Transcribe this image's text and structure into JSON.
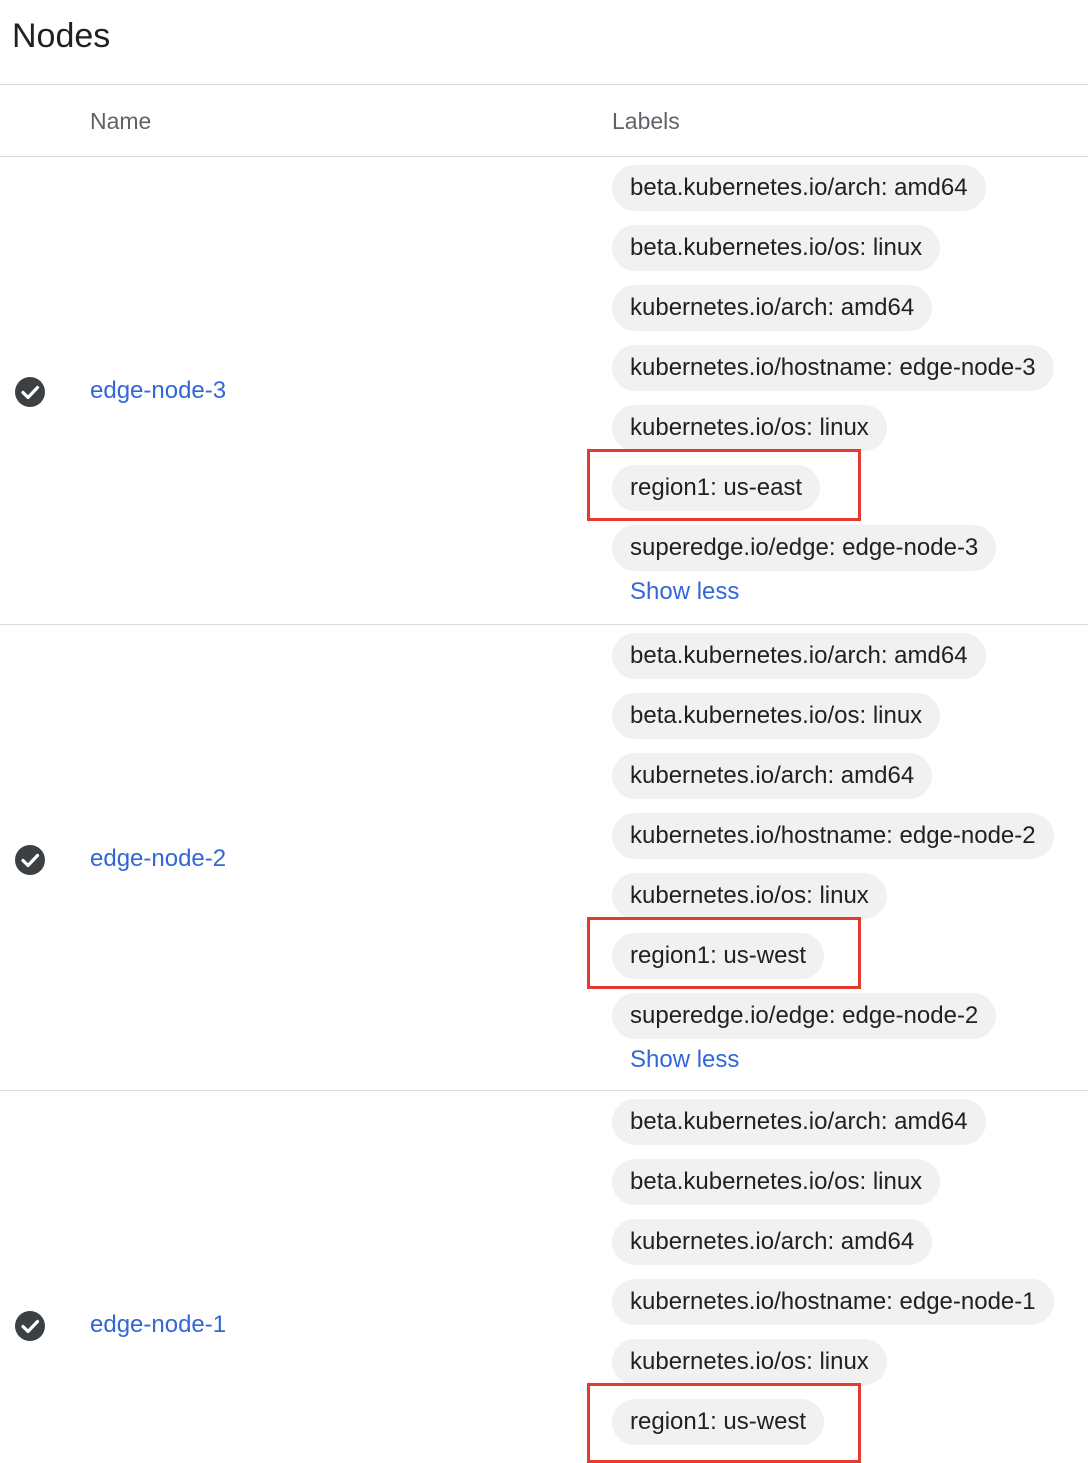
{
  "page": {
    "title": "Nodes"
  },
  "table": {
    "columns": {
      "name": "Name",
      "labels": "Labels"
    },
    "show_less_label": "Show less",
    "rows": [
      {
        "name": "edge-node-3",
        "status": "check-circle-icon",
        "labels": [
          "beta.kubernetes.io/arch: amd64",
          "beta.kubernetes.io/os: linux",
          "kubernetes.io/arch: amd64",
          "kubernetes.io/hostname: edge-node-3",
          "kubernetes.io/os: linux",
          "region1: us-east",
          "superedge.io/edge: edge-node-3"
        ]
      },
      {
        "name": "edge-node-2",
        "status": "check-circle-icon",
        "labels": [
          "beta.kubernetes.io/arch: amd64",
          "beta.kubernetes.io/os: linux",
          "kubernetes.io/arch: amd64",
          "kubernetes.io/hostname: edge-node-2",
          "kubernetes.io/os: linux",
          "region1: us-west",
          "superedge.io/edge: edge-node-2"
        ]
      },
      {
        "name": "edge-node-1",
        "status": "check-circle-icon",
        "labels": [
          "beta.kubernetes.io/arch: amd64",
          "beta.kubernetes.io/os: linux",
          "kubernetes.io/arch: amd64",
          "kubernetes.io/hostname: edge-node-1",
          "kubernetes.io/os: linux",
          "region1: us-west"
        ]
      }
    ]
  },
  "colors": {
    "link": "#3367d6",
    "chip_bg": "#f1f1f1",
    "highlight_border": "#e33b2e",
    "status_ok": "#3c4043"
  }
}
